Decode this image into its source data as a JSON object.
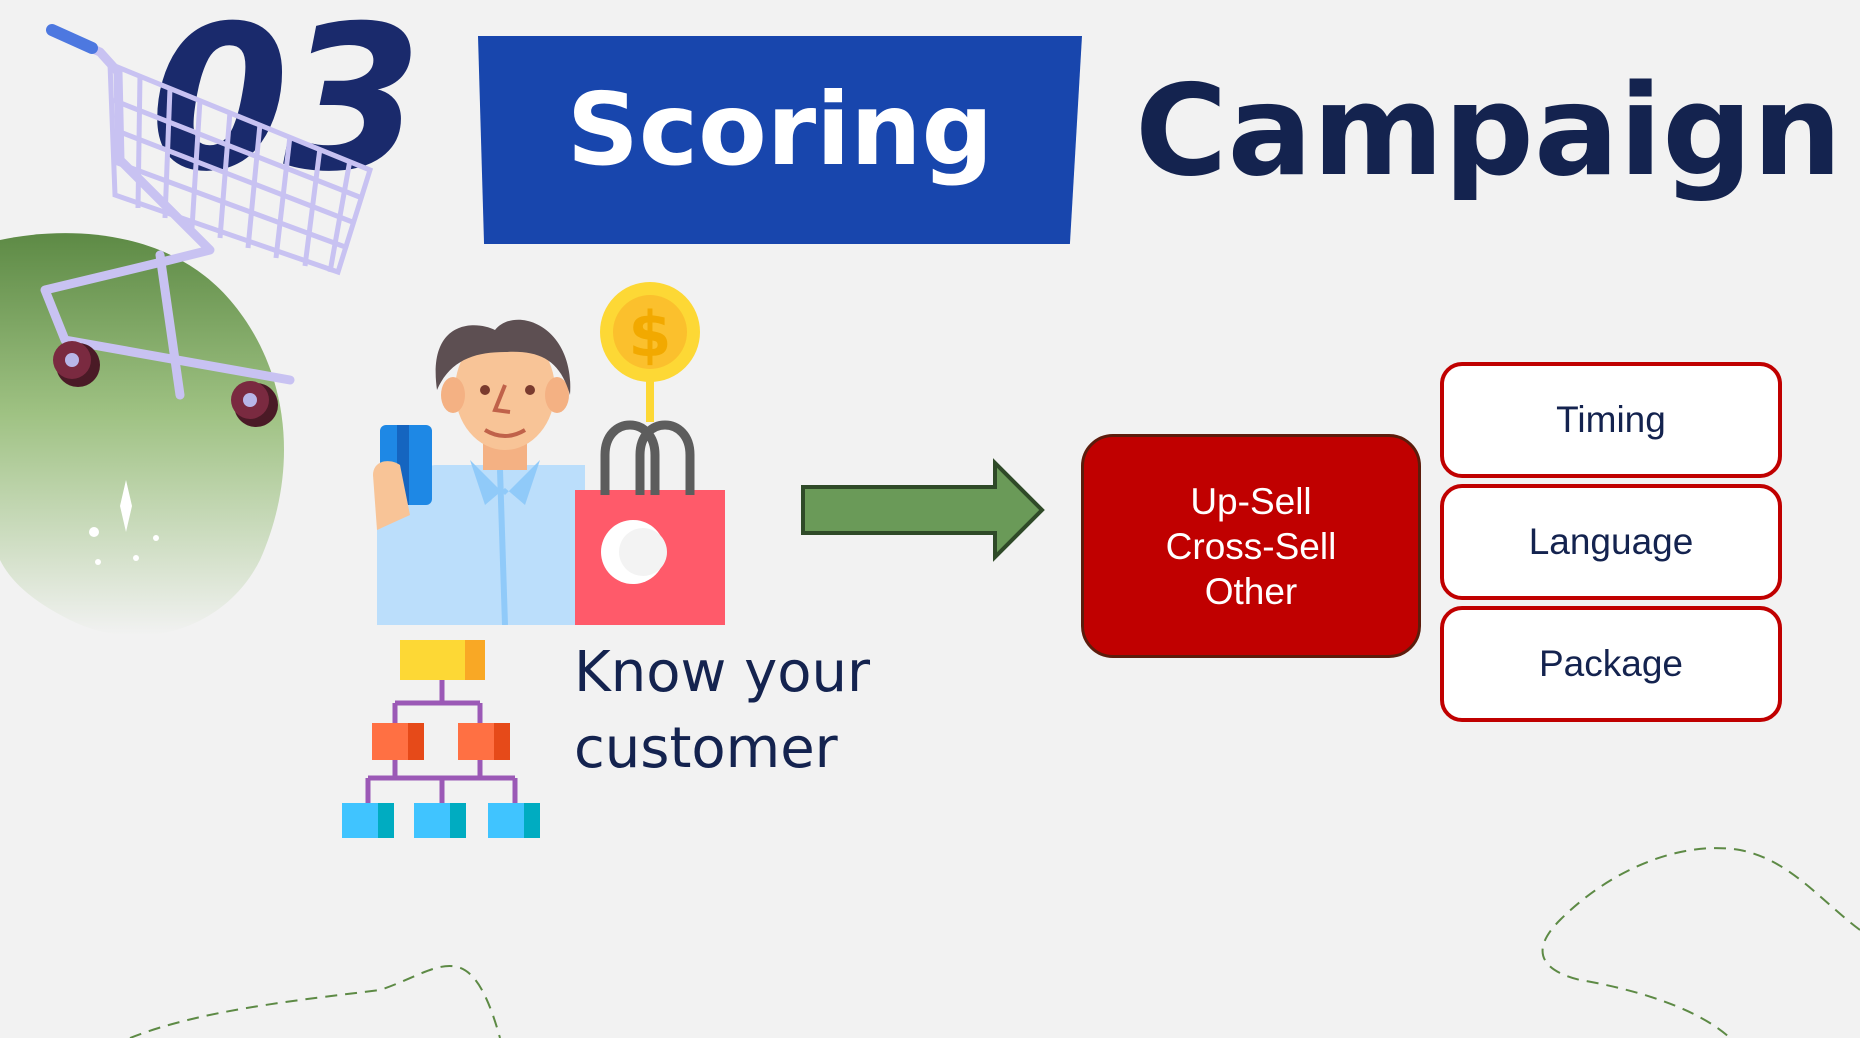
{
  "header": {
    "number": "03",
    "scoring_label": "Scoring",
    "campaign_label": "Campaign"
  },
  "customer": {
    "line1": "Know your",
    "line2": "customer"
  },
  "campaign_types": {
    "items": [
      "Up-Sell",
      "Cross-Sell",
      "Other"
    ]
  },
  "options": {
    "items": [
      "Timing",
      "Language",
      "Package"
    ]
  },
  "colors": {
    "navy": "#14234f",
    "blue_banner": "#1846ad",
    "red_box": "#c00000",
    "arrow_green": "#6a9a58",
    "background": "#f2f2f2"
  }
}
